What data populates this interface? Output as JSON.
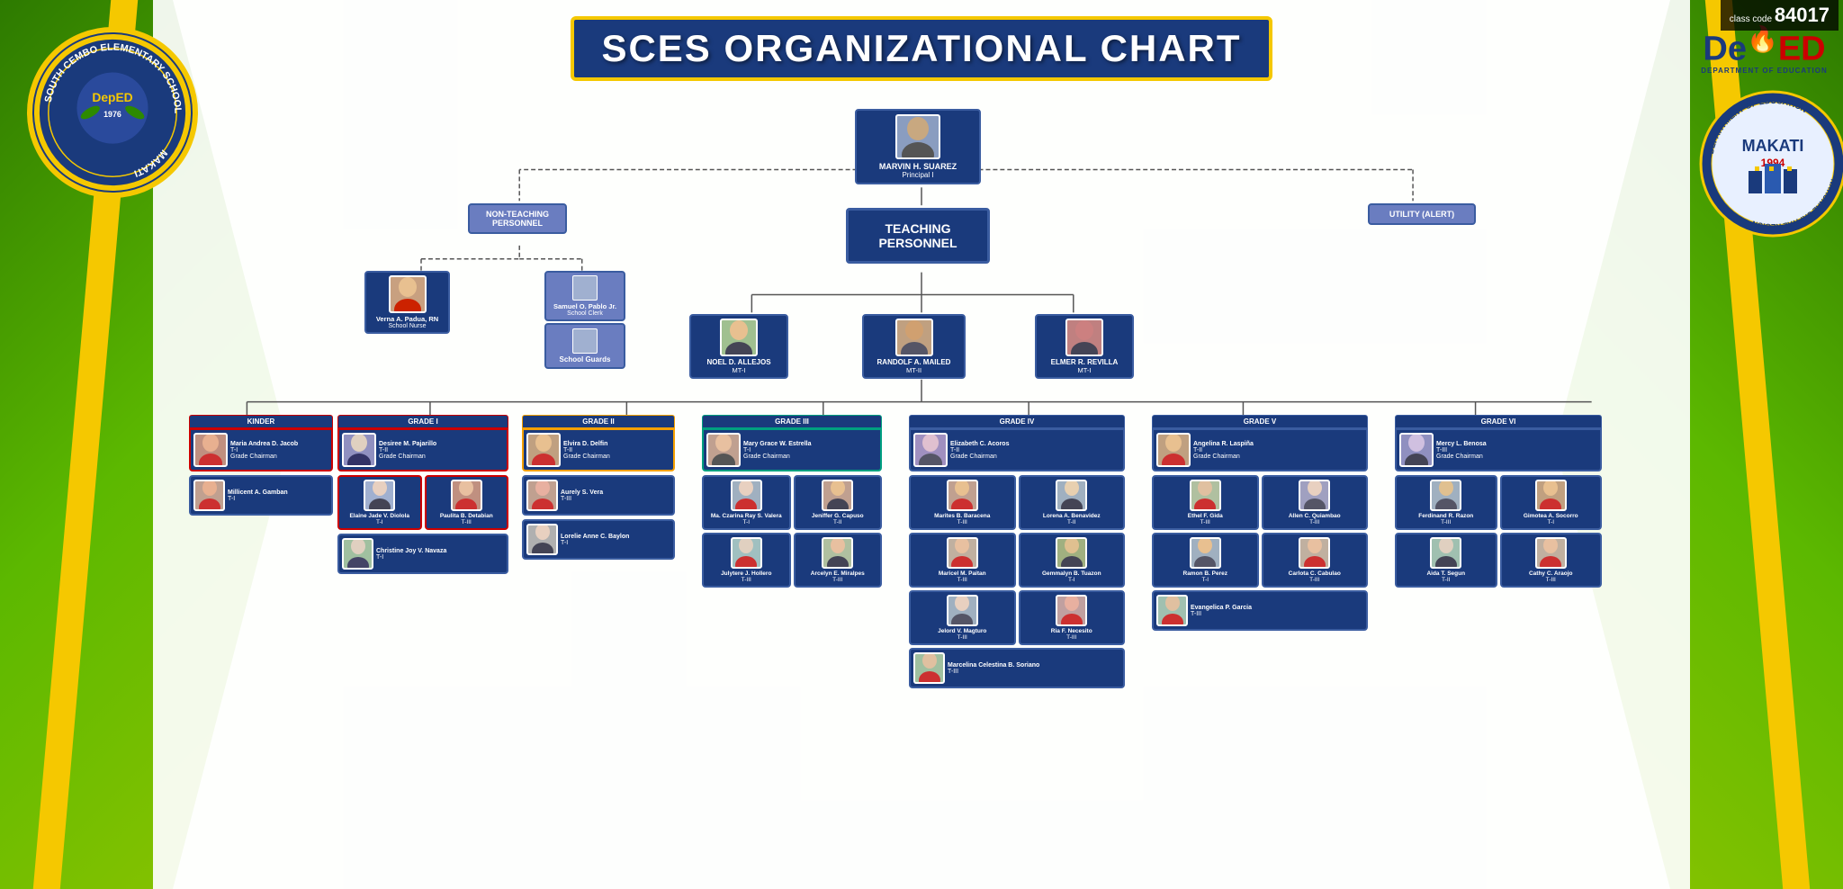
{
  "class_code": "84017",
  "title": "SCES ORGANIZATIONAL CHART",
  "school_name": "SOUTH CEMBO ELEMENTARY SCHOOL",
  "school_year": "1976",
  "school_location": "MAKATI",
  "deped": {
    "name": "DepED",
    "subtitle": "DEPARTMENT OF EDUCATION"
  },
  "makati_seal": "MAKATI 1994 NATIONAL CAPITAL REGION",
  "principal": {
    "name": "MARVIN H. SUAREZ",
    "role": "Principal I"
  },
  "non_teaching_label": "NON-TEACHING PERSONNEL",
  "utility_label": "UTILITY (ALERT)",
  "teaching_label": "TEACHING PERSONNEL",
  "non_teaching_staff": [
    {
      "name": "Verna A. Padua, RN",
      "role": "School Nurse"
    },
    {
      "name": "Samuel O. Pablo Jr.",
      "role": "School Clerk"
    },
    {
      "name": "School Guards",
      "role": ""
    }
  ],
  "master_teachers": [
    {
      "name": "NOEL D. ALLEJOS",
      "role": "MT-I"
    },
    {
      "name": "RANDOLF A. MAILED",
      "role": "MT-II"
    },
    {
      "name": "ELMER R. REVILLA",
      "role": "MT-I"
    }
  ],
  "grades": [
    {
      "grade": "KINDER",
      "chairman": {
        "name": "Maria Andrea D. Jacob",
        "role": "T-I",
        "title": "Grade Chairman"
      },
      "teachers": [
        {
          "name": "Millicent A. Gamban",
          "role": "T-I"
        }
      ]
    },
    {
      "grade": "GRADE I",
      "chairman": {
        "name": "Desiree M. Pajarillo",
        "role": "T-II",
        "title": "Grade Chairman"
      },
      "teachers": [
        {
          "name": "Elaine Jade V. Diolola",
          "role": "T-I"
        },
        {
          "name": "Paulita B. Detabian",
          "role": "T-III"
        },
        {
          "name": "Christine Joy V. Navaza",
          "role": "T-I"
        }
      ]
    },
    {
      "grade": "GRADE II",
      "chairman": {
        "name": "Elvira D. Delfin",
        "role": "T-II",
        "title": "Grade Chairman"
      },
      "teachers": [
        {
          "name": "Aurely S. Vera",
          "role": "T-III"
        },
        {
          "name": "Lorelie Anne C. Baylon",
          "role": "T-I"
        }
      ]
    },
    {
      "grade": "GRADE III",
      "chairman": {
        "name": "Mary Grace W. Estrella",
        "role": "T-I",
        "title": "Grade Chairman"
      },
      "teachers": [
        {
          "name": "Ma. Czarina Ray S. Valera",
          "role": "T-I"
        },
        {
          "name": "Jeniffer G. Capuso",
          "role": "T-II"
        },
        {
          "name": "Julytere J. Hollero",
          "role": "T-III"
        },
        {
          "name": "Arcelyn E. Miralpes",
          "role": "T-III"
        }
      ]
    },
    {
      "grade": "GRADE IV",
      "chairman": {
        "name": "Elizabeth C. Acoros",
        "role": "T-II",
        "title": "Grade Chairman"
      },
      "teachers": [
        {
          "name": "Marites B. Baracena",
          "role": "T-III"
        },
        {
          "name": "Lorena A. Benavidez",
          "role": "T-II"
        },
        {
          "name": "Maricel M. Paitan",
          "role": "T-III"
        },
        {
          "name": "Gemmalyn B. Tuazon",
          "role": "T-I"
        },
        {
          "name": "Jelord V. Magturo",
          "role": "T-III"
        },
        {
          "name": "Ria F. Necesito",
          "role": "T-III"
        },
        {
          "name": "Marcelina Celestina B. Soriano",
          "role": "T-III"
        }
      ]
    },
    {
      "grade": "GRADE V",
      "chairman": {
        "name": "Angelina R. Laspiña",
        "role": "T-II",
        "title": "Grade Chairman"
      },
      "teachers": [
        {
          "name": "Ethel F. Gida",
          "role": "T-III"
        },
        {
          "name": "Allen C. Quiambao",
          "role": "T-III"
        },
        {
          "name": "Ramon B. Perez",
          "role": "T-I"
        },
        {
          "name": "Carlota C. Cabulao",
          "role": "T-III"
        },
        {
          "name": "Evangelica P. Garcia",
          "role": "T-III"
        }
      ]
    },
    {
      "grade": "GRADE VI",
      "chairman": {
        "name": "Mercy L. Benosa",
        "role": "T-III",
        "title": "Grade Chairman"
      },
      "teachers": [
        {
          "name": "Ferdinand R. Razon",
          "role": "T-III"
        },
        {
          "name": "Aida T. Segun",
          "role": "T-II"
        },
        {
          "name": "Gimotea A. Socorro",
          "role": "T-I"
        },
        {
          "name": "Cathy C. Araojo",
          "role": "T-III"
        }
      ]
    }
  ]
}
